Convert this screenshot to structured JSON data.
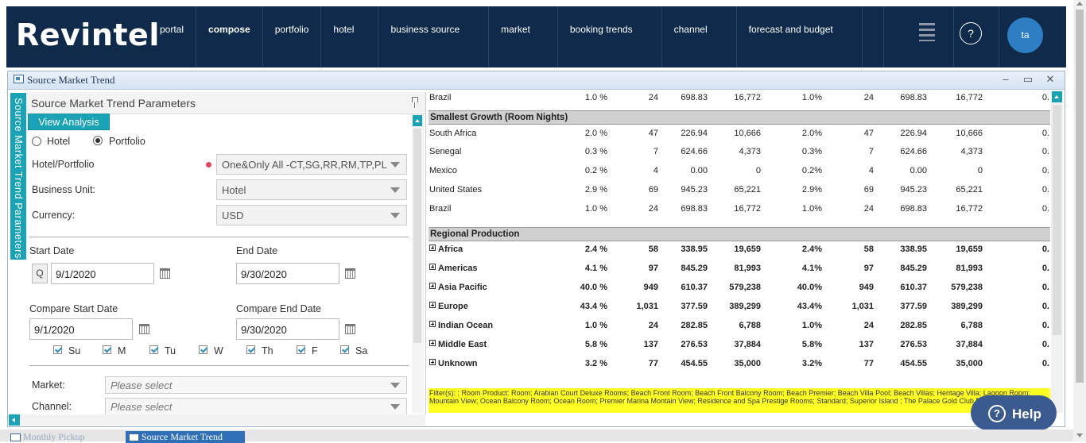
{
  "app": {
    "logo": "Revintel"
  },
  "nav": {
    "items": [
      "portal",
      "compose",
      "portfolio",
      "hotel",
      "business source",
      "market",
      "booking trends",
      "channel",
      "forecast and budget"
    ],
    "active": "compose",
    "user_initials": "ta",
    "help_symbol": "?"
  },
  "window": {
    "title": "Source Market Trend",
    "buttons": {
      "minimize": "–",
      "maximize": "▭",
      "close": "✕"
    }
  },
  "params": {
    "side_tab": "Source Market Trend Parameters",
    "title": "Source Market Trend Parameters",
    "view_button": "View Analysis",
    "radio_hotel": "Hotel",
    "radio_portfolio": "Portfolio",
    "selected_mode": "Portfolio",
    "hotel_portfolio_label": "Hotel/Portfolio",
    "hotel_portfolio_value": "One&Only All -CT,SG,RR,RM,TP,PL",
    "business_unit_label": "Business Unit:",
    "business_unit_value": "Hotel",
    "currency_label": "Currency:",
    "currency_value": "USD",
    "start_date_label": "Start Date",
    "start_date": "9/1/2020",
    "end_date_label": "End Date",
    "end_date": "9/30/2020",
    "q_label": "Q",
    "compare_start_label": "Compare Start Date",
    "compare_start": "9/1/2020",
    "compare_end_label": "Compare End Date",
    "compare_end": "9/30/2020",
    "days": [
      "Su",
      "M",
      "Tu",
      "W",
      "Th",
      "F",
      "Sa"
    ],
    "market_label": "Market:",
    "market_placeholder": "Please select",
    "channel_label": "Channel:",
    "channel_placeholder": "Please select"
  },
  "grid": {
    "top_row": {
      "name": "Brazil",
      "p1": "1.0 %",
      "n1": "24",
      "a1": "698.83",
      "r1": "16,772",
      "p2": "1.0%",
      "n2": "24",
      "a2": "698.83",
      "r2": "16,772",
      "last": "0."
    },
    "sections": [
      {
        "title": "Smallest Growth (Room Nights)",
        "rows": [
          {
            "name": "South Africa",
            "p1": "2.0 %",
            "n1": "47",
            "a1": "226.94",
            "r1": "10,666",
            "p2": "2.0%",
            "n2": "47",
            "a2": "226.94",
            "r2": "10,666",
            "last": "0."
          },
          {
            "name": "Senegal",
            "p1": "0.3 %",
            "n1": "7",
            "a1": "624.66",
            "r1": "4,373",
            "p2": "0.3%",
            "n2": "7",
            "a2": "624.66",
            "r2": "4,373",
            "last": "0."
          },
          {
            "name": "Mexico",
            "p1": "0.2 %",
            "n1": "4",
            "a1": "0.00",
            "r1": "0",
            "p2": "0.2%",
            "n2": "4",
            "a2": "0.00",
            "r2": "0",
            "last": "0."
          },
          {
            "name": "United States",
            "p1": "2.9 %",
            "n1": "69",
            "a1": "945.23",
            "r1": "65,221",
            "p2": "2.9%",
            "n2": "69",
            "a2": "945.23",
            "r2": "65,221",
            "last": "0."
          },
          {
            "name": "Brazil",
            "p1": "1.0 %",
            "n1": "24",
            "a1": "698.83",
            "r1": "16,772",
            "p2": "1.0%",
            "n2": "24",
            "a2": "698.83",
            "r2": "16,772",
            "last": "0."
          }
        ]
      },
      {
        "title": "Regional Production",
        "rows": [
          {
            "name": "Africa",
            "p1": "2.4 %",
            "n1": "58",
            "a1": "338.95",
            "r1": "19,659",
            "p2": "2.4%",
            "n2": "58",
            "a2": "338.95",
            "r2": "19,659",
            "last": "0."
          },
          {
            "name": "Americas",
            "p1": "4.1 %",
            "n1": "97",
            "a1": "845.29",
            "r1": "81,993",
            "p2": "4.1%",
            "n2": "97",
            "a2": "845.29",
            "r2": "81,993",
            "last": "0."
          },
          {
            "name": "Asia Pacific",
            "p1": "40.0 %",
            "n1": "949",
            "a1": "610.37",
            "r1": "579,238",
            "p2": "40.0%",
            "n2": "949",
            "a2": "610.37",
            "r2": "579,238",
            "last": "0."
          },
          {
            "name": "Europe",
            "p1": "43.4 %",
            "n1": "1,031",
            "a1": "377.59",
            "r1": "389,299",
            "p2": "43.4%",
            "n2": "1,031",
            "a2": "377.59",
            "r2": "389,299",
            "last": "0."
          },
          {
            "name": "Indian Ocean",
            "p1": "1.0 %",
            "n1": "24",
            "a1": "282.85",
            "r1": "6,788",
            "p2": "1.0%",
            "n2": "24",
            "a2": "282.85",
            "r2": "6,788",
            "last": "0."
          },
          {
            "name": "Middle East",
            "p1": "5.8 %",
            "n1": "137",
            "a1": "276.53",
            "r1": "37,884",
            "p2": "5.8%",
            "n2": "137",
            "a2": "276.53",
            "r2": "37,884",
            "last": "0."
          },
          {
            "name": "Unknown",
            "p1": "3.2 %",
            "n1": "77",
            "a1": "454.55",
            "r1": "35,000",
            "p2": "3.2%",
            "n2": "77",
            "a2": "454.55",
            "r2": "35,000",
            "last": "0."
          }
        ]
      }
    ],
    "filter_text": "Filter(s):  ; Room Product: Room; Arabian Court Deluxe Rooms; Beach Front  Room; Beach Front Balcony Room; Beach Premier; Beach Villa Pool; Beach Villas; Heritage Villa; Lagoon Room; Mountain View; Ocean Balcony Room; Ocean Room; Premier Marina Montain View; Residence and Spa Prestige Rooms; Standard; Superior Island ; The Palace Gold Club Pool"
  },
  "help_widget": {
    "label": "Help",
    "symbol": "?"
  },
  "taskbar": {
    "items": [
      "Monthly Pickup",
      "Source Market Trend"
    ]
  },
  "colors": {
    "navy": "#0f2a4a",
    "teal": "#1aa3b6",
    "filter_yellow": "#ffff24",
    "help_blue": "#3b5a8f"
  }
}
